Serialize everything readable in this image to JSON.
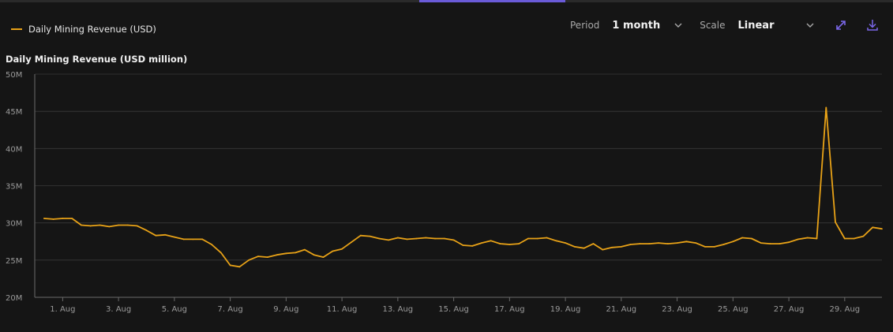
{
  "legend": {
    "label": "Daily Mining Revenue (USD)"
  },
  "controls": {
    "period_label": "Period",
    "period_value": "1 month",
    "scale_label": "Scale",
    "scale_value": "Linear"
  },
  "icons": {
    "expand": "expand-arrows-icon",
    "download": "download-icon",
    "dropdown": "chevron-down-icon"
  },
  "colors": {
    "series": "#e8a217",
    "accent": "#7a66e8",
    "background": "#151515",
    "grid": "#3a3a3a"
  },
  "chart_data": {
    "type": "line",
    "title": "Daily Mining Revenue (USD million)",
    "xlabel": "",
    "ylabel": "",
    "ylim": [
      20,
      50
    ],
    "xlim": [
      "2024-07-31T00:00",
      "2024-08-30T08:00"
    ],
    "y_ticks": [
      {
        "value": 50,
        "label": "50M"
      },
      {
        "value": 45,
        "label": "45M"
      },
      {
        "value": 40,
        "label": "40M"
      },
      {
        "value": 35,
        "label": "35M"
      },
      {
        "value": 30,
        "label": "30M"
      },
      {
        "value": 25,
        "label": "25M"
      },
      {
        "value": 20,
        "label": "20M"
      }
    ],
    "x_ticks": [
      {
        "value": "2024-08-01",
        "label": "1. Aug"
      },
      {
        "value": "2024-08-03",
        "label": "3. Aug"
      },
      {
        "value": "2024-08-05",
        "label": "5. Aug"
      },
      {
        "value": "2024-08-07",
        "label": "7. Aug"
      },
      {
        "value": "2024-08-09",
        "label": "9. Aug"
      },
      {
        "value": "2024-08-11",
        "label": "11. Aug"
      },
      {
        "value": "2024-08-13",
        "label": "13. Aug"
      },
      {
        "value": "2024-08-15",
        "label": "15. Aug"
      },
      {
        "value": "2024-08-17",
        "label": "17. Aug"
      },
      {
        "value": "2024-08-19",
        "label": "19. Aug"
      },
      {
        "value": "2024-08-21",
        "label": "21. Aug"
      },
      {
        "value": "2024-08-23",
        "label": "23. Aug"
      },
      {
        "value": "2024-08-25",
        "label": "25. Aug"
      },
      {
        "value": "2024-08-27",
        "label": "27. Aug"
      },
      {
        "value": "2024-08-29",
        "label": "29. Aug"
      }
    ],
    "grid": true,
    "legend_position": "top-left",
    "series": [
      {
        "name": "Daily Mining Revenue (USD)",
        "color": "#e8a217",
        "points": [
          [
            "2024-07-31T08:00",
            30.6
          ],
          [
            "2024-07-31T16:00",
            30.5
          ],
          [
            "2024-08-01T00:00",
            30.6
          ],
          [
            "2024-08-01T08:00",
            30.6
          ],
          [
            "2024-08-01T16:00",
            29.7
          ],
          [
            "2024-08-02T00:00",
            29.6
          ],
          [
            "2024-08-02T08:00",
            29.7
          ],
          [
            "2024-08-02T16:00",
            29.5
          ],
          [
            "2024-08-03T00:00",
            29.7
          ],
          [
            "2024-08-03T08:00",
            29.7
          ],
          [
            "2024-08-03T16:00",
            29.6
          ],
          [
            "2024-08-04T00:00",
            29.0
          ],
          [
            "2024-08-04T08:00",
            28.3
          ],
          [
            "2024-08-04T16:00",
            28.4
          ],
          [
            "2024-08-05T00:00",
            28.1
          ],
          [
            "2024-08-05T08:00",
            27.8
          ],
          [
            "2024-08-05T16:00",
            27.8
          ],
          [
            "2024-08-06T00:00",
            27.8
          ],
          [
            "2024-08-06T08:00",
            27.1
          ],
          [
            "2024-08-06T16:00",
            26.0
          ],
          [
            "2024-08-07T00:00",
            24.3
          ],
          [
            "2024-08-07T08:00",
            24.1
          ],
          [
            "2024-08-07T16:00",
            25.0
          ],
          [
            "2024-08-08T00:00",
            25.5
          ],
          [
            "2024-08-08T08:00",
            25.4
          ],
          [
            "2024-08-08T16:00",
            25.7
          ],
          [
            "2024-08-09T00:00",
            25.9
          ],
          [
            "2024-08-09T08:00",
            26.0
          ],
          [
            "2024-08-09T16:00",
            26.4
          ],
          [
            "2024-08-10T00:00",
            25.7
          ],
          [
            "2024-08-10T08:00",
            25.4
          ],
          [
            "2024-08-10T16:00",
            26.2
          ],
          [
            "2024-08-11T00:00",
            26.5
          ],
          [
            "2024-08-11T08:00",
            27.4
          ],
          [
            "2024-08-11T16:00",
            28.3
          ],
          [
            "2024-08-12T00:00",
            28.2
          ],
          [
            "2024-08-12T08:00",
            27.9
          ],
          [
            "2024-08-12T16:00",
            27.7
          ],
          [
            "2024-08-13T00:00",
            28.0
          ],
          [
            "2024-08-13T08:00",
            27.8
          ],
          [
            "2024-08-13T16:00",
            27.9
          ],
          [
            "2024-08-14T00:00",
            28.0
          ],
          [
            "2024-08-14T08:00",
            27.9
          ],
          [
            "2024-08-14T16:00",
            27.9
          ],
          [
            "2024-08-15T00:00",
            27.7
          ],
          [
            "2024-08-15T08:00",
            27.0
          ],
          [
            "2024-08-15T16:00",
            26.9
          ],
          [
            "2024-08-16T00:00",
            27.3
          ],
          [
            "2024-08-16T08:00",
            27.6
          ],
          [
            "2024-08-16T16:00",
            27.2
          ],
          [
            "2024-08-17T00:00",
            27.1
          ],
          [
            "2024-08-17T08:00",
            27.2
          ],
          [
            "2024-08-17T16:00",
            27.9
          ],
          [
            "2024-08-18T00:00",
            27.9
          ],
          [
            "2024-08-18T08:00",
            28.0
          ],
          [
            "2024-08-18T16:00",
            27.6
          ],
          [
            "2024-08-19T00:00",
            27.3
          ],
          [
            "2024-08-19T08:00",
            26.8
          ],
          [
            "2024-08-19T16:00",
            26.6
          ],
          [
            "2024-08-20T00:00",
            27.2
          ],
          [
            "2024-08-20T08:00",
            26.4
          ],
          [
            "2024-08-20T16:00",
            26.7
          ],
          [
            "2024-08-21T00:00",
            26.8
          ],
          [
            "2024-08-21T08:00",
            27.1
          ],
          [
            "2024-08-21T16:00",
            27.2
          ],
          [
            "2024-08-22T00:00",
            27.2
          ],
          [
            "2024-08-22T08:00",
            27.3
          ],
          [
            "2024-08-22T16:00",
            27.2
          ],
          [
            "2024-08-23T00:00",
            27.3
          ],
          [
            "2024-08-23T08:00",
            27.5
          ],
          [
            "2024-08-23T16:00",
            27.3
          ],
          [
            "2024-08-24T00:00",
            26.8
          ],
          [
            "2024-08-24T08:00",
            26.8
          ],
          [
            "2024-08-24T16:00",
            27.1
          ],
          [
            "2024-08-25T00:00",
            27.5
          ],
          [
            "2024-08-25T08:00",
            28.0
          ],
          [
            "2024-08-25T16:00",
            27.9
          ],
          [
            "2024-08-26T00:00",
            27.3
          ],
          [
            "2024-08-26T08:00",
            27.2
          ],
          [
            "2024-08-26T16:00",
            27.2
          ],
          [
            "2024-08-27T00:00",
            27.4
          ],
          [
            "2024-08-27T08:00",
            27.8
          ],
          [
            "2024-08-27T16:00",
            28.0
          ],
          [
            "2024-08-28T00:00",
            27.9
          ],
          [
            "2024-08-28T08:00",
            45.5
          ],
          [
            "2024-08-28T16:00",
            30.1
          ],
          [
            "2024-08-29T00:00",
            27.9
          ],
          [
            "2024-08-29T08:00",
            27.9
          ],
          [
            "2024-08-29T16:00",
            28.2
          ],
          [
            "2024-08-30T00:00",
            29.4
          ],
          [
            "2024-08-30T08:00",
            29.2
          ]
        ]
      }
    ]
  }
}
